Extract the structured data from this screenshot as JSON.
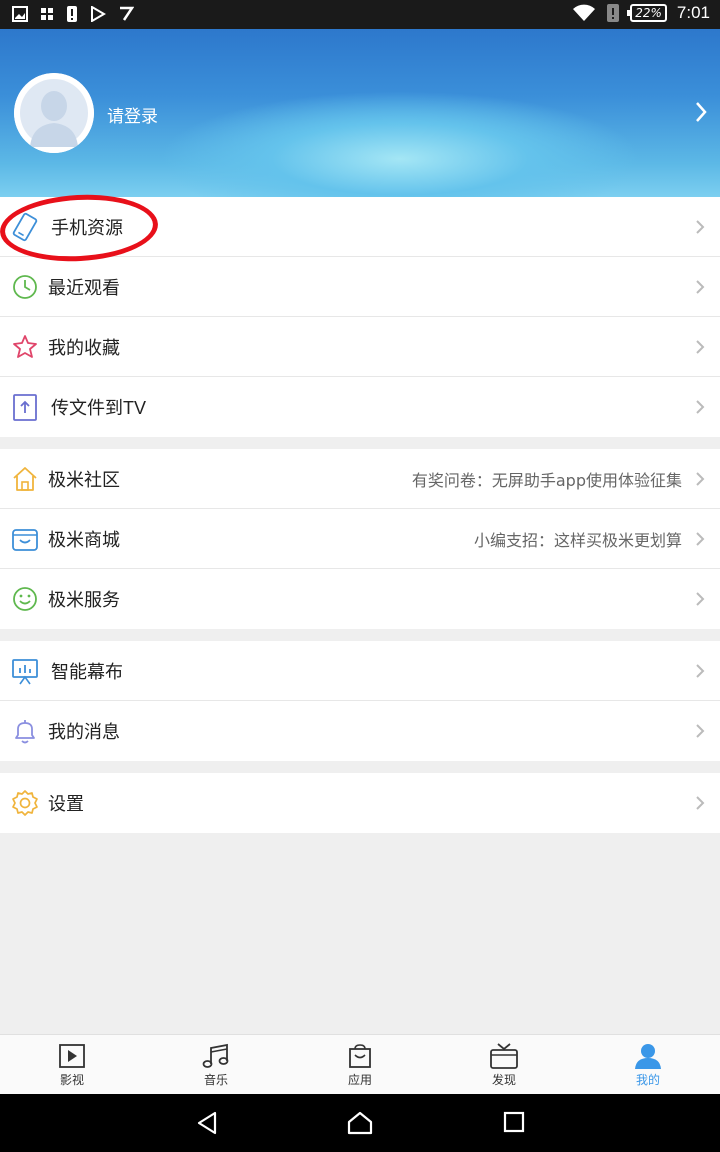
{
  "status_bar": {
    "battery": "22%",
    "time": "7:01"
  },
  "header": {
    "login_text": "请登录"
  },
  "menu_group_1": [
    {
      "id": "phone-resources",
      "label": "手机资源",
      "icon": "phone-icon"
    },
    {
      "id": "recent",
      "label": "最近观看",
      "icon": "clock-icon"
    },
    {
      "id": "favorites",
      "label": "我的收藏",
      "icon": "star-icon"
    },
    {
      "id": "send-to-tv",
      "label": "传文件到TV",
      "icon": "upload-file-icon"
    }
  ],
  "menu_group_2": [
    {
      "id": "community",
      "label": "极米社区",
      "hint": "有奖问卷：无屏助手app使用体验征集",
      "icon": "house-icon"
    },
    {
      "id": "store",
      "label": "极米商城",
      "hint": "小编支招：这样买极米更划算",
      "icon": "shopping-basket-icon"
    },
    {
      "id": "service",
      "label": "极米服务",
      "icon": "smile-icon"
    }
  ],
  "menu_group_3": [
    {
      "id": "smart-screen",
      "label": "智能幕布",
      "icon": "projector-screen-icon"
    },
    {
      "id": "messages",
      "label": "我的消息",
      "icon": "bell-icon"
    }
  ],
  "menu_group_4": [
    {
      "id": "settings",
      "label": "设置",
      "icon": "gear-icon"
    }
  ],
  "tabs": [
    {
      "label": "影视",
      "icon": "play-icon"
    },
    {
      "label": "音乐",
      "icon": "music-note-icon"
    },
    {
      "label": "应用",
      "icon": "shopping-bag-icon"
    },
    {
      "label": "发现",
      "icon": "tv-icon"
    },
    {
      "label": "我的",
      "icon": "person-icon",
      "active": true
    }
  ],
  "colors": {
    "accent": "#3a97e8",
    "highlight": "#e8101a"
  }
}
